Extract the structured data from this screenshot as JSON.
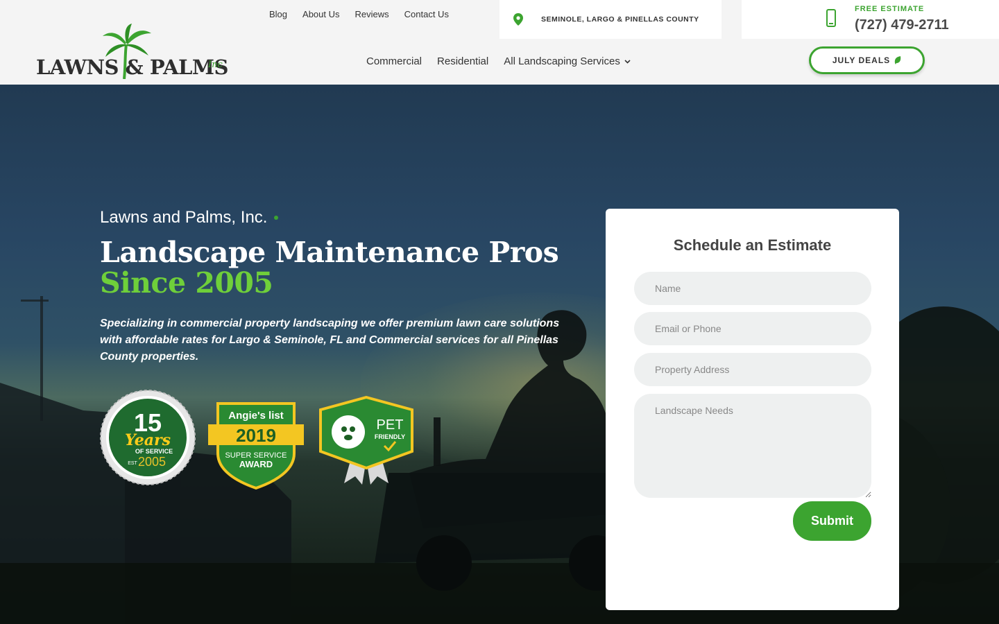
{
  "header": {
    "logo": {
      "text": "LAWNS & PALMS",
      "suffix": "Inc"
    },
    "top_nav": [
      "Blog",
      "About Us",
      "Reviews",
      "Contact Us"
    ],
    "location": "SEMINOLE, LARGO & PINELLAS COUNTY",
    "phone": {
      "label": "FREE ESTIMATE",
      "number": "(727) 479-2711"
    },
    "main_nav": {
      "commercial": "Commercial",
      "residential": "Residential",
      "services": "All Landscaping Services"
    },
    "deals_button": "JULY DEALS"
  },
  "hero": {
    "tagline": "Lawns and Palms, Inc.",
    "headline_line1": "Landscape Maintenance Pros",
    "headline_line2": "Since 2005",
    "description": "Specializing in commercial property landscaping we offer premium lawn care solutions with affordable rates for Largo & Seminole, FL and Commercial services for all Pinellas County properties.",
    "badges": {
      "years": {
        "number": "15",
        "word": "Years",
        "sub": "OF SERVICE",
        "est": "EST",
        "year": "2005"
      },
      "angies": {
        "brand": "Angie's list",
        "year": "2019",
        "line1": "SUPER SERVICE",
        "line2": "AWARD"
      },
      "pet": {
        "line1": "PET",
        "line2": "FRIENDLY"
      }
    }
  },
  "form": {
    "title": "Schedule an Estimate",
    "name_placeholder": "Name",
    "email_placeholder": "Email or Phone",
    "address_placeholder": "Property Address",
    "needs_placeholder": "Landscape Needs",
    "submit": "Submit"
  },
  "colors": {
    "brand_green": "#3ca430",
    "accent_green": "#6fcf3a",
    "text_dark": "#333333",
    "field_bg": "#eef0f0"
  }
}
